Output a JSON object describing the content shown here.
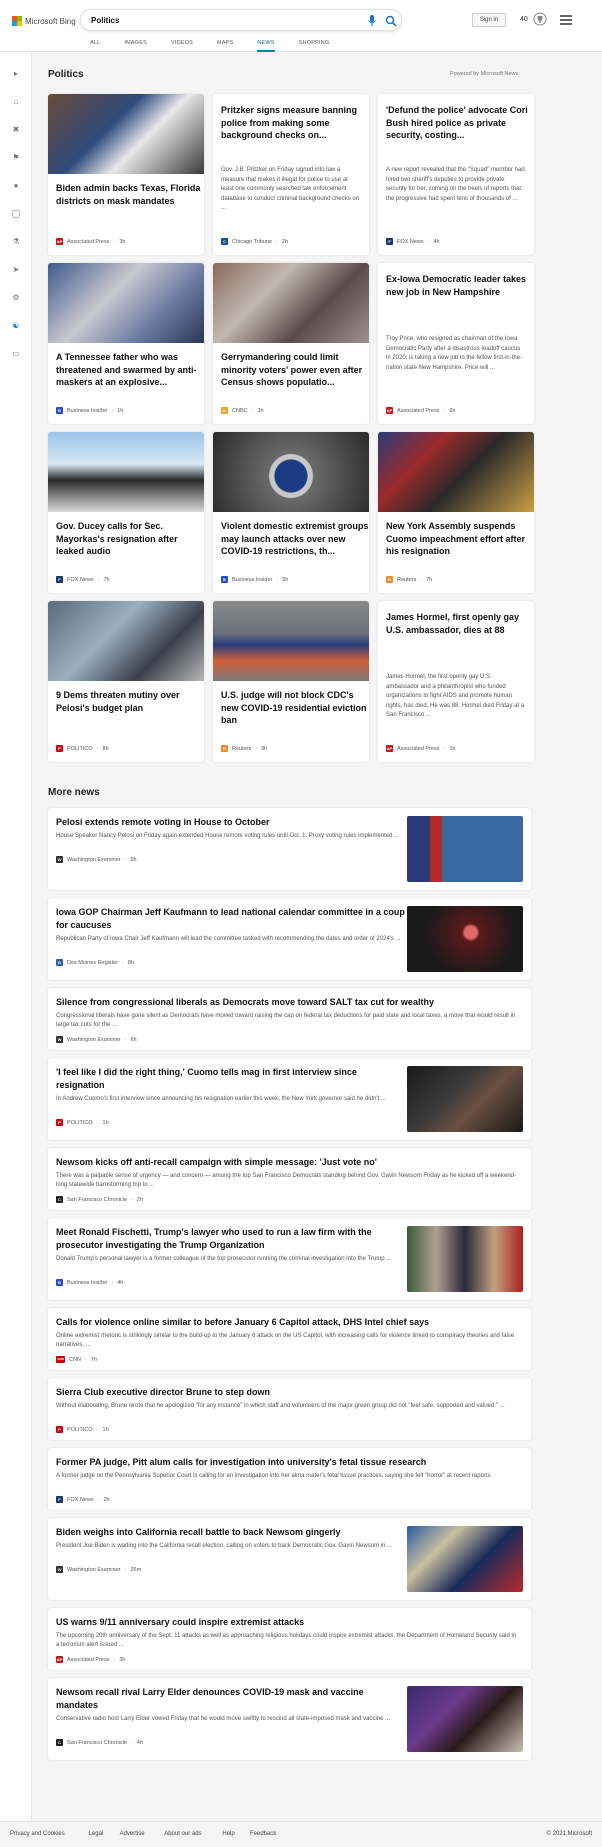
{
  "header": {
    "logo_text": "Microsoft Bing",
    "search_query": "Politics",
    "signin": "Sign in",
    "rewards_points": "40"
  },
  "tabs": [
    {
      "label": "ALL"
    },
    {
      "label": "IMAGES"
    },
    {
      "label": "VIDEOS"
    },
    {
      "label": "MAPS"
    },
    {
      "label": "NEWS",
      "active": true
    },
    {
      "label": "SHOPPING"
    }
  ],
  "politics": {
    "title": "Politics",
    "powered_by": "Powered by Microsoft News",
    "cards": [
      {
        "title": "Biden admin backs Texas, Florida districts on mask mandates",
        "source": "Associated Press",
        "time": "3h",
        "badge": "AP",
        "badge_color": "#c4161c"
      },
      {
        "title": "Pritzker signs measure banning police from making some background checks on...",
        "desc": "Gov. J.B. Pritzker on Friday signed into law a measure that makes it illegal for police to use at least one commonly searched law enforcement database to conduct criminal background checks on ...",
        "source": "Chicago Tribune",
        "time": "2h",
        "badge": "C",
        "badge_color": "#1a4f8a"
      },
      {
        "title": "'Defund the police' advocate Cori Bush hired police as private security, costing...",
        "desc": "A new report revealed that the \"Squad\" member had hired two sheriff's deputies to provide private security for her, coming on the heels of reports that the progressive had spent tens of thousands of ...",
        "source": "FOX News",
        "time": "4h",
        "badge": "F",
        "badge_color": "#1b3a70"
      },
      {
        "title": "A Tennessee father who was threatened and swarmed by anti-maskers at an explosive...",
        "source": "Business Insider",
        "time": "1h",
        "badge": "B",
        "badge_color": "#2451c5"
      },
      {
        "title": "Gerrymandering could limit minority voters' power even after Census shows populatio...",
        "source": "CNBC",
        "time": "3h",
        "badge": "N",
        "badge_color": "#e3a73b"
      },
      {
        "title": "Ex-Iowa Democratic leader takes new job in New Hampshire",
        "desc": "Troy Price, who resigned as chairman of the Iowa Democratic Party after a disastrous Ieadoff caucus in 2020, is taking a new job in the fellow first-in-the-nation state New Hampshire. Price will ...",
        "source": "Associated Press",
        "time": "6h",
        "badge": "AP",
        "badge_color": "#c4161c"
      },
      {
        "title": "Gov. Ducey calls for Sec. Mayorkas's resignation after leaked audio",
        "source": "FOX News",
        "time": "7h",
        "badge": "F",
        "badge_color": "#1b3a70"
      },
      {
        "title": "Violent domestic extremist groups may launch attacks over new COVID-19 restrictions, th...",
        "source": "Business Insider",
        "time": "5h",
        "badge": "B",
        "badge_color": "#2451c5"
      },
      {
        "title": "New York Assembly suspends Cuomo impeachment effort after his resignation",
        "source": "Reuters",
        "time": "7h",
        "badge": "R",
        "badge_color": "#f08b2b"
      },
      {
        "title": "9 Dems threaten mutiny over Pelosi's budget plan",
        "source": "POLITICO",
        "time": "8h",
        "badge": "P",
        "badge_color": "#d0021b"
      },
      {
        "title": "U.S. judge will not block CDC's new COVID-19 residential eviction ban",
        "source": "Reuters",
        "time": "9h",
        "badge": "R",
        "badge_color": "#f08b2b"
      },
      {
        "title": "James Hormel, first openly gay U.S. ambassador, dies at 88",
        "desc": "James Hormel, the first openly gay U.S. ambassador and a philanthropist who funded organizations to fight AIDS and promote human rights, has died. He was 88. Hormel died Friday at a San Francisco ...",
        "source": "Associated Press",
        "time": "1h",
        "badge": "AP",
        "badge_color": "#c4161c"
      }
    ]
  },
  "more_news": {
    "title": "More news",
    "items": [
      {
        "title": "Pelosi extends remote voting in House to October",
        "desc": "House Speaker Nancy Pelosi on Friday again extended House remote voting rules until Oct. 1. Proxy voting rules implemented ...",
        "source": "Washington Examiner",
        "time": "5h",
        "badge": "W",
        "badge_color": "#333"
      },
      {
        "title": "Iowa GOP Chairman Jeff Kaufmann to lead national calendar committee in a coup for caucuses",
        "desc": "Republican Party of Iowa Chair Jeff Kaufmann will lead the committee tasked with recommending the dates and order of 2024's ...",
        "source": "Des Moines Register",
        "time": "8h",
        "badge": "D",
        "badge_color": "#3361a8"
      },
      {
        "title": "Silence from congressional liberals as Democrats move toward SALT tax cut for wealthy",
        "desc": "Congressional liberals have gone silent as Democrats have moved toward raising the cap on federal tax deductions for paid state and local taxes, a move that would result in large tax cuts for the ...",
        "source": "Washington Examiner",
        "time": "6h",
        "badge": "W",
        "badge_color": "#333"
      },
      {
        "title": "'I feel like I did the right thing,' Cuomo tells mag in first interview since resignation",
        "desc": "In Andrew Cuomo's first interview since announcing his resignation earlier this week, the New York governor said he didn't ...",
        "source": "POLITICO",
        "time": "1h",
        "badge": "P",
        "badge_color": "#d0021b"
      },
      {
        "title": "Newsom kicks off anti-recall campaign with simple message: 'Just vote no'",
        "desc": "There was a palpable sense of urgency — and concern — among the top San Francisco Democrats standing behind Gov. Gavin Newsom Friday as he kicked off a weekend-long statewide barnstorming trip to ...",
        "source": "San Francisco Chronicle",
        "time": "2h",
        "badge": "C",
        "badge_color": "#222"
      },
      {
        "title": "Meet Ronald Fischetti, Trump's lawyer who used to run a law firm with the prosecutor investigating the Trump Organization",
        "desc": "Donald Trump's personal lawyer is a former colleague of the top prosecutor running the criminal investigation into the Trump ...",
        "source": "Business Insider",
        "time": "4h",
        "badge": "B",
        "badge_color": "#2451c5"
      },
      {
        "title": "Calls for violence online similar to before January 6 Capitol attack, DHS Intel chief says",
        "desc": "Online extremist rhetoric is strikingly similar to the build-up to the January 6 attack on the US Capitol, with increasing calls for violence linked to conspiracy theories and false narratives, ...",
        "source": "CNN",
        "time": "7h",
        "badge": "CNN",
        "badge_color": "#cc0000"
      },
      {
        "title": "Sierra Club executive director Brune to step down",
        "desc": "Without elaborating, Brune wrote that he apologized \"for any instance\" in which staff and volunteers of the major green group did not \"feel safe, supported and valued.\" ...",
        "source": "POLITICO",
        "time": "1h",
        "badge": "P",
        "badge_color": "#d0021b"
      },
      {
        "title": "Former PA judge, Pitt alum calls for investigation into university's fetal tissue research",
        "desc": "A former judge on the Pennsylvania Superior Court is calling for an investigation into her alma mater's fetal tissue practices, saying she felt \"horror\" at recent reports",
        "source": "FOX News",
        "time": "2h",
        "badge": "F",
        "badge_color": "#1b3a70"
      },
      {
        "title": "Biden weighs into California recall battle to back Newsom gingerly",
        "desc": "President Joe Biden is wading into the California recall election, calling on voters to back Democratic Gov. Gavin Newsom in ...",
        "source": "Washington Examiner",
        "time": "26m",
        "badge": "W",
        "badge_color": "#333"
      },
      {
        "title": "US warns 9/11 anniversary could inspire extremist attacks",
        "desc": "The upcoming 20th anniversary of the Sept. 11 attacks as well as approaching religious holidays could inspire extremist attacks, the Department of Homeland Security said in a terrorism alert issued ...",
        "source": "Associated Press",
        "time": "3h",
        "badge": "AP",
        "badge_color": "#c4161c"
      },
      {
        "title": "Newsom recall rival Larry Elder denounces COVID-19 mask and vaccine mandates",
        "desc": "Conservative radio host Larry Elder vowed Friday that he would move swiftly to rescind all state-imposed mask and vaccine ...",
        "source": "San Francisco Chronicle",
        "time": "4h",
        "badge": "C",
        "badge_color": "#222"
      }
    ]
  },
  "footer": {
    "links": [
      "Privacy and Cookies",
      "Legal",
      "Advertise",
      "About our ads",
      "Help",
      "Feedback"
    ],
    "copyright": "© 2021 Microsoft"
  }
}
